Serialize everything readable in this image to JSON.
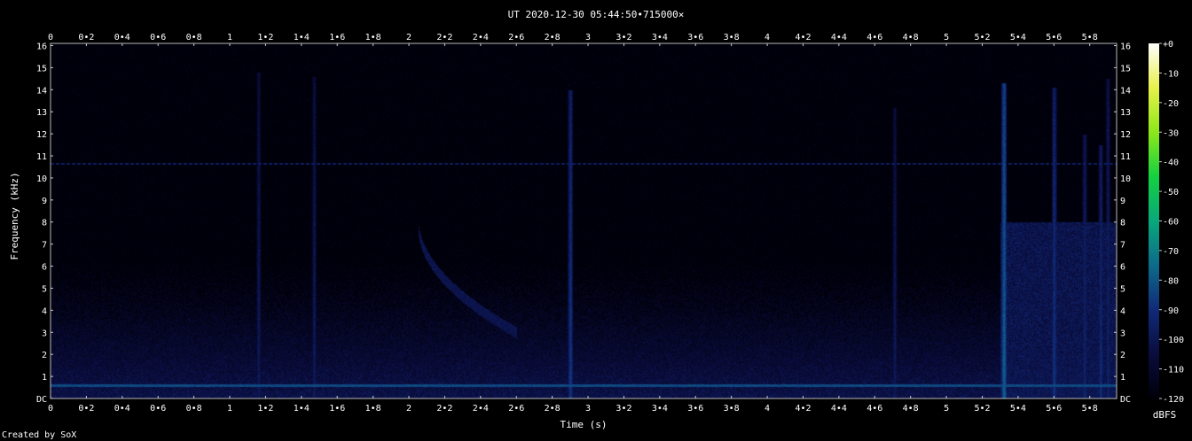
{
  "chart_data": {
    "type": "heatmap",
    "title": "UT 2020-12-30 05:44:50•715000×",
    "xlabel": "Time (s)",
    "ylabel": "Frequency (kHz)",
    "x_range": [
      0,
      5.95
    ],
    "y_range": [
      0,
      16.1
    ],
    "x_ticks": [
      "0",
      "0•2",
      "0•4",
      "0•6",
      "0•8",
      "1",
      "1•2",
      "1•4",
      "1•6",
      "1•8",
      "2",
      "2•2",
      "2•4",
      "2•6",
      "2•8",
      "3",
      "3•2",
      "3•4",
      "3•6",
      "3•8",
      "4",
      "4•2",
      "4•4",
      "4•6",
      "4•8",
      "5",
      "5•2",
      "5•4",
      "5•6",
      "5•8"
    ],
    "x_tick_values": [
      0,
      0.2,
      0.4,
      0.6,
      0.8,
      1.0,
      1.2,
      1.4,
      1.6,
      1.8,
      2.0,
      2.2,
      2.4,
      2.6,
      2.8,
      3.0,
      3.2,
      3.4,
      3.6,
      3.8,
      4.0,
      4.2,
      4.4,
      4.6,
      4.8,
      5.0,
      5.2,
      5.4,
      5.6,
      5.8
    ],
    "y_ticks": [
      "DC",
      "1",
      "2",
      "3",
      "4",
      "5",
      "6",
      "7",
      "8",
      "9",
      "10",
      "11",
      "12",
      "13",
      "14",
      "15",
      "16"
    ],
    "y_tick_values": [
      0,
      1,
      2,
      3,
      4,
      5,
      6,
      7,
      8,
      9,
      10,
      11,
      12,
      13,
      14,
      15,
      16
    ],
    "colorbar": {
      "label": "dBFS",
      "ticks": [
        "+0",
        "-10",
        "-20",
        "-30",
        "-40",
        "-50",
        "-60",
        "-70",
        "-80",
        "-90",
        "-100",
        "-110",
        "-120"
      ],
      "tick_values": [
        0,
        -10,
        -20,
        -30,
        -40,
        -50,
        -60,
        -70,
        -80,
        -90,
        -100,
        -110,
        -120
      ],
      "range": [
        -120,
        0
      ]
    },
    "features": {
      "hum_line_khz": 0.6,
      "tone_line_khz": 10.65,
      "vertical_events": [
        {
          "t": 1.16,
          "f_top": 14.8,
          "level_db": -95
        },
        {
          "t": 1.47,
          "f_top": 14.6,
          "level_db": -95
        },
        {
          "t": 2.9,
          "f_top": 14.0,
          "level_db": -85
        },
        {
          "t": 4.71,
          "f_top": 13.2,
          "level_db": -95
        },
        {
          "t": 5.32,
          "f_top": 14.3,
          "level_db": -75
        },
        {
          "t": 5.6,
          "f_top": 14.1,
          "level_db": -85
        },
        {
          "t": 5.77,
          "f_top": 12.0,
          "level_db": -90
        },
        {
          "t": 5.86,
          "f_top": 11.5,
          "level_db": -88
        },
        {
          "t": 5.9,
          "f_top": 14.5,
          "level_db": -92
        }
      ],
      "chirp": {
        "t_start": 2.05,
        "f_start": 8.0,
        "t_end": 2.6,
        "f_end": 3.0
      }
    },
    "grid": false,
    "legend": "colorbar-right"
  },
  "footer": {
    "credit": "Created by SoX"
  },
  "colors": {
    "background": "#000000",
    "text": "#ffffff",
    "colormap": [
      "#00000a",
      "#0a0c3c",
      "#102a78",
      "#0d6a8a",
      "#08a87a",
      "#14d040",
      "#8ce81a",
      "#e8f04a",
      "#ffffff"
    ]
  }
}
